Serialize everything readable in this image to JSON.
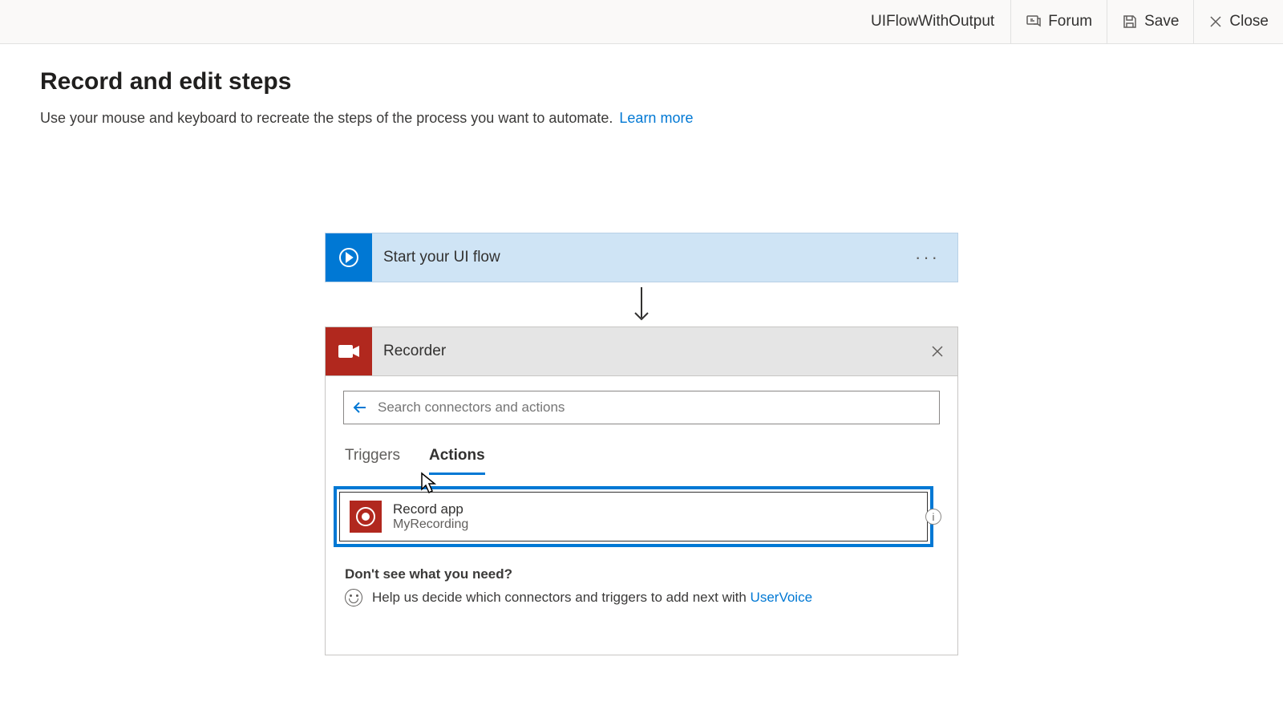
{
  "topbar": {
    "flow_name": "UIFlowWithOutput",
    "forum_label": "Forum",
    "save_label": "Save",
    "close_label": "Close"
  },
  "page": {
    "heading": "Record and edit steps",
    "subtext": "Use your mouse and keyboard to recreate the steps of the process you want to automate.",
    "learn_more": "Learn more"
  },
  "flow": {
    "start_step": "Start your UI flow",
    "recorder_step": "Recorder"
  },
  "search": {
    "placeholder": "Search connectors and actions"
  },
  "tabs": {
    "triggers": "Triggers",
    "actions": "Actions"
  },
  "action": {
    "title": "Record app",
    "subtitle": "MyRecording"
  },
  "help": {
    "question": "Don't see what you need?",
    "line_prefix": "Help us decide which connectors and triggers to add next with ",
    "link": "UserVoice"
  }
}
